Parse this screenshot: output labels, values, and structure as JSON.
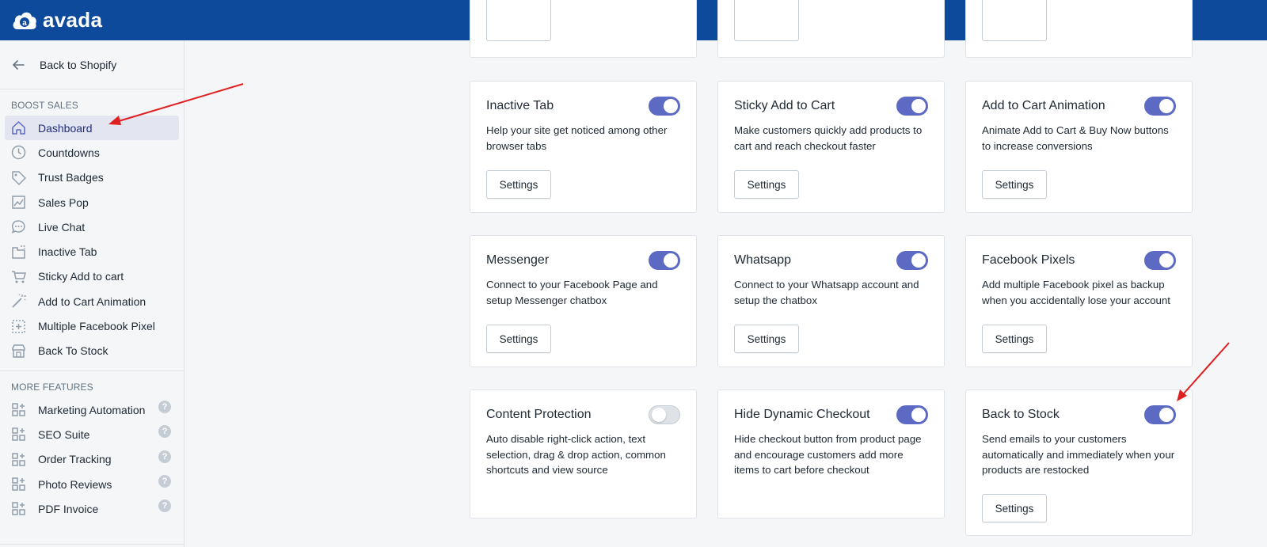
{
  "brand": {
    "name": "avada",
    "logo_letter": "a"
  },
  "colors": {
    "topbar": "#0d4a9b",
    "toggle_on": "#5c6ac4",
    "toggle_off": "#dfe3e8",
    "active_nav_bg": "#e3e5f0",
    "arrow": "#e02020"
  },
  "sidebar": {
    "back_label": "Back to Shopify",
    "boost_title": "BOOST SALES",
    "boost_items": [
      {
        "label": "Dashboard",
        "icon": "home-icon",
        "active": true
      },
      {
        "label": "Countdowns",
        "icon": "clock-icon"
      },
      {
        "label": "Trust Badges",
        "icon": "tag-icon"
      },
      {
        "label": "Sales Pop",
        "icon": "chart-icon"
      },
      {
        "label": "Live Chat",
        "icon": "chat-icon"
      },
      {
        "label": "Inactive Tab",
        "icon": "browser-tab-icon"
      },
      {
        "label": "Sticky Add to cart",
        "icon": "cart-icon"
      },
      {
        "label": "Add to Cart Animation",
        "icon": "magic-wand-icon"
      },
      {
        "label": "Multiple Facebook Pixel",
        "icon": "pixel-icon"
      },
      {
        "label": "Back To Stock",
        "icon": "store-icon"
      }
    ],
    "more_title": "MORE FEATURES",
    "more_items": [
      {
        "label": "Marketing Automation",
        "icon": "apps-icon",
        "help": "?"
      },
      {
        "label": "SEO Suite",
        "icon": "apps-icon",
        "help": "?"
      },
      {
        "label": "Order Tracking",
        "icon": "apps-icon",
        "help": "?"
      },
      {
        "label": "Photo Reviews",
        "icon": "apps-icon",
        "help": "?"
      },
      {
        "label": "PDF Invoice",
        "icon": "apps-icon",
        "help": "?"
      }
    ]
  },
  "cards": [
    {
      "title": "Inactive Tab",
      "desc": "Help your site get noticed among other browser tabs",
      "enabled": true,
      "button": "Settings"
    },
    {
      "title": "Sticky Add to Cart",
      "desc": "Make customers quickly add products to cart and reach checkout faster",
      "enabled": true,
      "button": "Settings"
    },
    {
      "title": "Add to Cart Animation",
      "desc": "Animate Add to Cart & Buy Now buttons to increase conversions",
      "enabled": true,
      "button": "Settings"
    },
    {
      "title": "Messenger",
      "desc": "Connect to your Facebook Page and setup Messenger chatbox",
      "enabled": true,
      "button": "Settings"
    },
    {
      "title": "Whatsapp",
      "desc": "Connect to your Whatsapp account and setup the chatbox",
      "enabled": true,
      "button": "Settings"
    },
    {
      "title": "Facebook Pixels",
      "desc": "Add multiple Facebook pixel as backup when you accidentally lose your account",
      "enabled": true,
      "button": "Settings"
    },
    {
      "title": "Content Protection",
      "desc": "Auto disable right-click action, text selection, drag & drop action, common shortcuts and view source",
      "enabled": false
    },
    {
      "title": "Hide Dynamic Checkout",
      "desc": "Hide checkout button from product page and encourage customers add more items to cart before checkout",
      "enabled": true
    },
    {
      "title": "Back to Stock",
      "desc": "Send emails to your customers automatically and immediately when your products are restocked",
      "enabled": true,
      "button": "Settings"
    }
  ]
}
